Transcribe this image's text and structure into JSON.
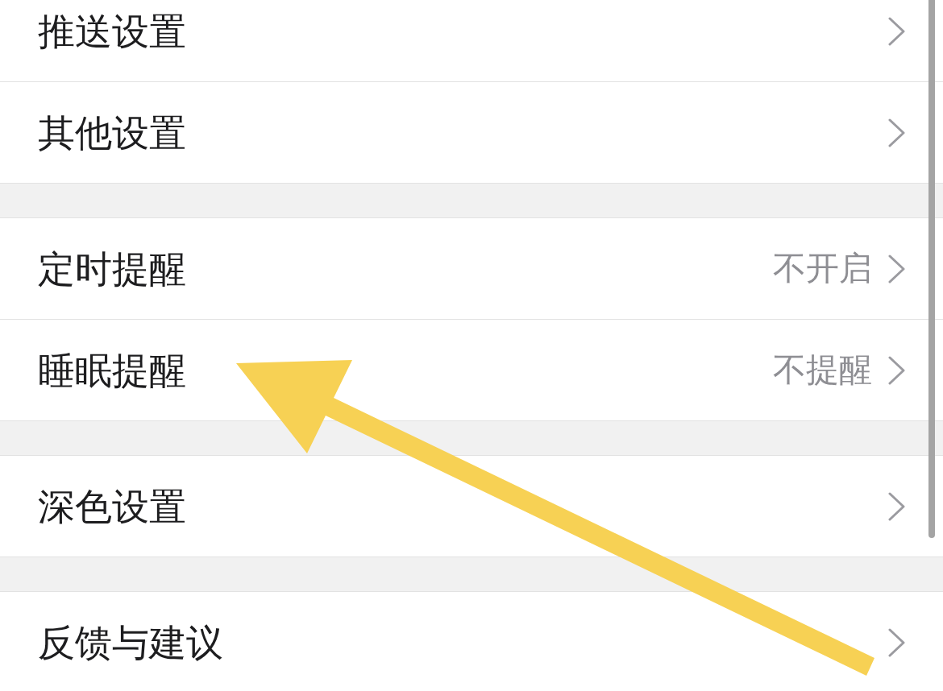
{
  "settings": {
    "groups": [
      {
        "items": [
          {
            "label": "推送设置"
          },
          {
            "label": "其他设置"
          }
        ]
      },
      {
        "items": [
          {
            "label": "定时提醒",
            "value": "不开启"
          },
          {
            "label": "睡眠提醒",
            "value": "不提醒"
          }
        ]
      },
      {
        "items": [
          {
            "label": "深色设置"
          }
        ]
      },
      {
        "items": [
          {
            "label": "反馈与建议"
          }
        ]
      }
    ]
  }
}
